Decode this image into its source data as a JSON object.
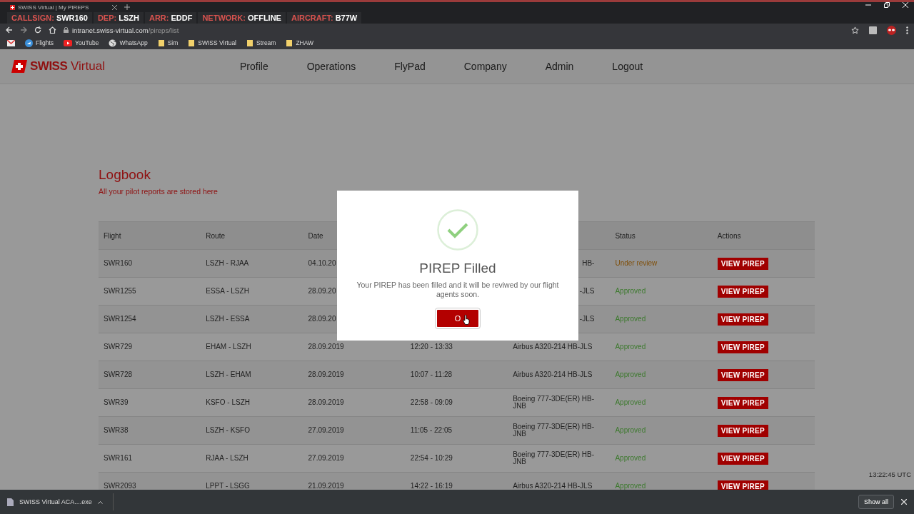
{
  "browser": {
    "tab_title": "SWISS Virtual | My PIREPS",
    "flight_info": [
      {
        "label": "CALLSIGN:",
        "value": "SWR160"
      },
      {
        "label": "DEP:",
        "value": "LSZH"
      },
      {
        "label": "ARR:",
        "value": "EDDF"
      },
      {
        "label": "NETWORK:",
        "value": "OFFLINE"
      },
      {
        "label": "AIRCRAFT:",
        "value": "B77W"
      }
    ],
    "url_host": "intranet.swiss-virtual.com",
    "url_path": "/pireps/list",
    "bookmarks": [
      {
        "label": "Flights",
        "kind": "plane"
      },
      {
        "label": "YouTube",
        "kind": "video"
      },
      {
        "label": "WhatsApp",
        "kind": "globe"
      },
      {
        "label": "Sim",
        "kind": "folder"
      },
      {
        "label": "SWISS Virtual",
        "kind": "folder"
      },
      {
        "label": "Stream",
        "kind": "folder"
      },
      {
        "label": "ZHAW",
        "kind": "folder"
      }
    ]
  },
  "header": {
    "logo_bold": "SWISS",
    "logo_light": "Virtual",
    "nav": [
      "Profile",
      "Operations",
      "FlyPad",
      "Company",
      "Admin",
      "Logout"
    ]
  },
  "logbook": {
    "title": "Logbook",
    "subtitle": "All your pilot reports are stored here",
    "columns": [
      "Flight",
      "Route",
      "Date",
      null,
      null,
      "Status",
      "Actions"
    ],
    "rows": [
      {
        "cells": [
          "SWR160",
          "LSZH - RJAA",
          "04.10.20",
          null,
          "HB-"
        ],
        "status": "Under review",
        "color": "#7f4f0a",
        "action": "VIEW PIREP"
      },
      {
        "cells": [
          "SWR1255",
          "ESSA - LSZH",
          "28.09.20",
          null,
          "-JLS"
        ],
        "status": "Approved",
        "color": "#3d7a2e",
        "action": "VIEW PIREP"
      },
      {
        "cells": [
          "SWR1254",
          "LSZH - ESSA",
          "28.09.20",
          null,
          "-JLS"
        ],
        "status": "Approved",
        "color": "#3d7a2e",
        "action": "VIEW PIREP"
      },
      {
        "cells": [
          "SWR729",
          "EHAM - LSZH",
          "28.09.2019",
          "12:20 - 13:33",
          "Airbus A320-214 HB-JLS"
        ],
        "status": "Approved",
        "color": "#3d7a2e",
        "action": "VIEW PIREP"
      },
      {
        "cells": [
          "SWR728",
          "LSZH - EHAM",
          "28.09.2019",
          "10:07 - 11:28",
          "Airbus A320-214 HB-JLS"
        ],
        "status": "Approved",
        "color": "#3d7a2e",
        "action": "VIEW PIREP"
      },
      {
        "cells": [
          "SWR39",
          "KSFO - LSZH",
          "28.09.2019",
          "22:58 - 09:09",
          "Boeing 777-3DE(ER) HB-JNB"
        ],
        "status": "Approved",
        "color": "#3d7a2e",
        "action": "VIEW PIREP"
      },
      {
        "cells": [
          "SWR38",
          "LSZH - KSFO",
          "27.09.2019",
          "11:05 - 22:05",
          "Boeing 777-3DE(ER) HB-JNB"
        ],
        "status": "Approved",
        "color": "#3d7a2e",
        "action": "VIEW PIREP"
      },
      {
        "cells": [
          "SWR161",
          "RJAA - LSZH",
          "27.09.2019",
          "22:54 - 10:29",
          "Boeing 777-3DE(ER) HB-JNB"
        ],
        "status": "Approved",
        "color": "#3d7a2e",
        "action": "VIEW PIREP"
      },
      {
        "cells": [
          "SWR2093",
          "LPPT - LSGG",
          "21.09.2019",
          "14:22 - 16:19",
          "Airbus A320-214 HB-JLS"
        ],
        "status": "Approved",
        "color": "#3d7a2e",
        "action": "VIEW PIREP"
      }
    ]
  },
  "utc_time": "13:22:45 UTC",
  "modal": {
    "title": "PIREP Filled",
    "message": "Your PIREP has been filled and it will be reviwed by our flight agents soon.",
    "button": "O"
  },
  "downloads": {
    "file": "SWISS Virtual ACA....exe",
    "show_all": "Show all"
  }
}
